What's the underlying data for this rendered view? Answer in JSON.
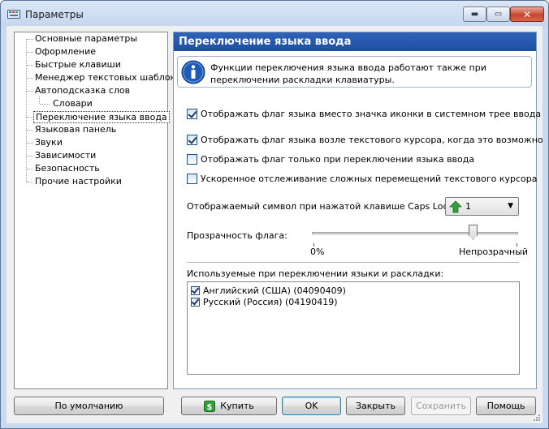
{
  "window": {
    "title": "Параметры",
    "controls": {
      "minimize": "▬",
      "maximize": "▭",
      "close": "✕"
    }
  },
  "tree": {
    "items": [
      {
        "label": "Основные параметры"
      },
      {
        "label": "Оформление"
      },
      {
        "label": "Быстрые клавиши"
      },
      {
        "label": "Менеджер текстовых шаблонов"
      },
      {
        "label": "Автоподсказка слов"
      },
      {
        "label": "Словари"
      },
      {
        "label": "Переключение языка ввода",
        "selected": true
      },
      {
        "label": "Языковая панель"
      },
      {
        "label": "Звуки"
      },
      {
        "label": "Зависимости"
      },
      {
        "label": "Безопасность"
      },
      {
        "label": "Прочие настройки"
      }
    ]
  },
  "panel": {
    "title": "Переключение языка ввода",
    "info_text": "Функции переключения языка ввода работают также при переключении раскладки клавиатуры.",
    "options": [
      {
        "label": "Отображать флаг языка вместо значка иконки в системном трее ввода",
        "checked": true
      },
      {
        "label": "Отображать флаг языка возле текстового курсора, когда это возможно",
        "checked": true
      },
      {
        "label": "Отображать флаг только при переключении языка ввода",
        "checked": false
      },
      {
        "label": "Ускоренное отслеживание сложных перемещений текстового курсора",
        "checked": false
      }
    ],
    "caps_lock": {
      "label": "Отображаемый символ при нажатой клавише Caps Lock:",
      "value": "1",
      "icon": "green-up-arrow-icon"
    },
    "transparency": {
      "label": "Прозрачность флага:",
      "min_label": "0%",
      "max_label": "Непрозрачный",
      "value_fraction": 0.78
    },
    "languages": {
      "label": "Используемые при переключении языки и раскладки:",
      "items": [
        {
          "label": "Английский (США) (04090409)",
          "checked": true
        },
        {
          "label": "Русский (Россия) (04190419)",
          "checked": true
        }
      ]
    }
  },
  "buttons": {
    "defaults": "По умолчанию",
    "buy": "Купить",
    "ok": "OK",
    "close": "Закрыть",
    "save": "Сохранить",
    "help": "Помощь"
  },
  "colors": {
    "header": "#2e63b8",
    "accent_green": "#2fa13a",
    "info_blue": "#1e5bb5"
  }
}
